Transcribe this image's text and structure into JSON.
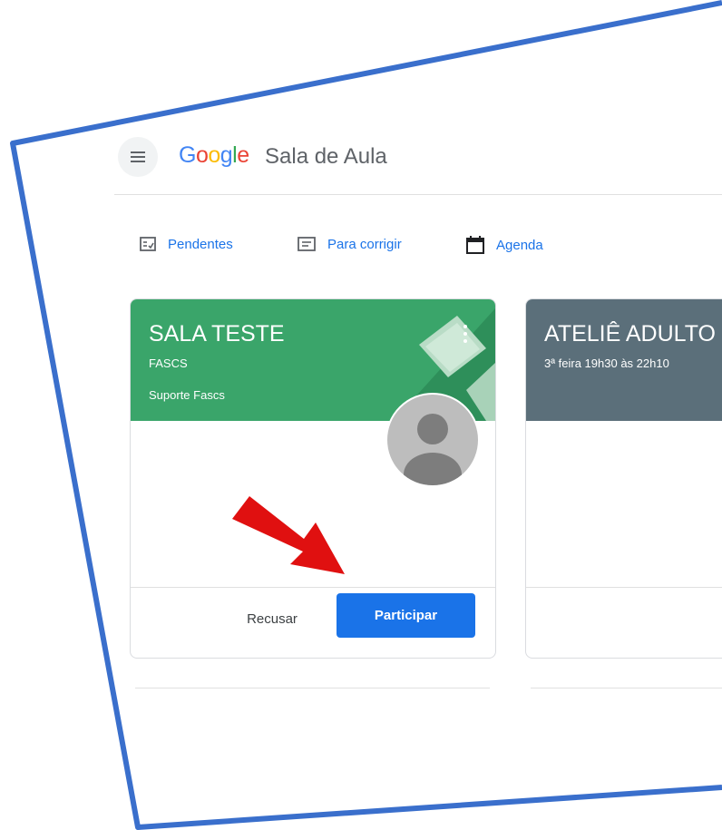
{
  "app": {
    "logo_word": "Google",
    "title": "Sala de Aula"
  },
  "nav": {
    "pending": "Pendentes",
    "to_review": "Para corrigir",
    "calendar": "Agenda"
  },
  "cards": [
    {
      "title": "SALA TESTE",
      "section": "FASCS",
      "owner": "Suporte Fascs",
      "header_color": "#3aa56a",
      "decline_label": "Recusar",
      "join_label": "Participar"
    },
    {
      "title": "ATELIÊ ADULTO",
      "section": "3ª feira 19h30 às 22h10",
      "header_color": "#5b6f7a"
    }
  ],
  "colors": {
    "accent": "#1a73e8",
    "frame_border": "#3a6fcc",
    "annotation_arrow": "#e01010"
  },
  "icons": {
    "menu": "hamburger-menu-icon",
    "pending": "assignment-checklist-icon",
    "to_review": "inbox-tray-icon",
    "calendar": "calendar-icon",
    "more": "more-vert-icon",
    "avatar": "person-avatar-icon",
    "annotation": "red-arrow-icon"
  }
}
